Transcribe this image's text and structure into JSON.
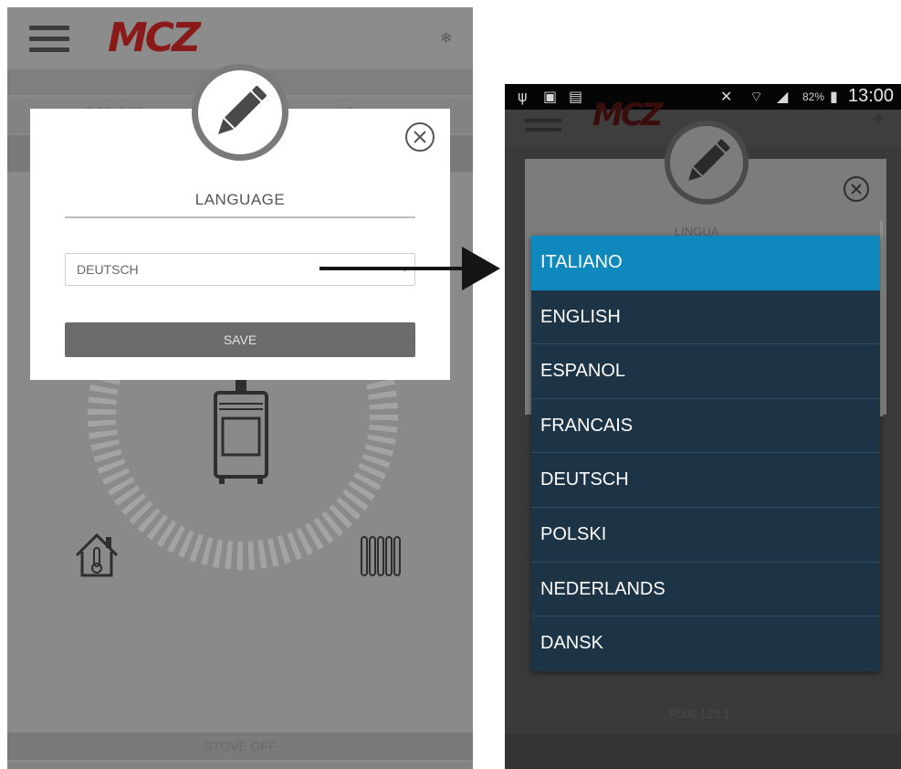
{
  "left_screen": {
    "brand": "MCZ",
    "band_text_left": "ECO OFF",
    "band_text_right": "NO",
    "dialog": {
      "title": "LANGUAGE",
      "selected_language": "DEUTSCH",
      "save_label": "SAVE"
    },
    "status": "STOVE OFF"
  },
  "right_screen": {
    "system_bar": {
      "battery_percent": "82%",
      "clock": "13:00"
    },
    "brand": "MCZ",
    "faded_dialog_title": "LINGUA",
    "faint_text": "P500 123 1",
    "languages": [
      "ITALIANO",
      "ENGLISH",
      "ESPANOL",
      "FRANCAIS",
      "DEUTSCH",
      "POLSKI",
      "NEDERLANDS",
      "DANSK"
    ],
    "highlighted_language": "ITALIANO"
  },
  "colors": {
    "brand_red": "#8a1a1a",
    "list_item_bg": "#1d3446",
    "list_selected_bg": "#0f88bd",
    "save_button": "#6b6b6b"
  }
}
